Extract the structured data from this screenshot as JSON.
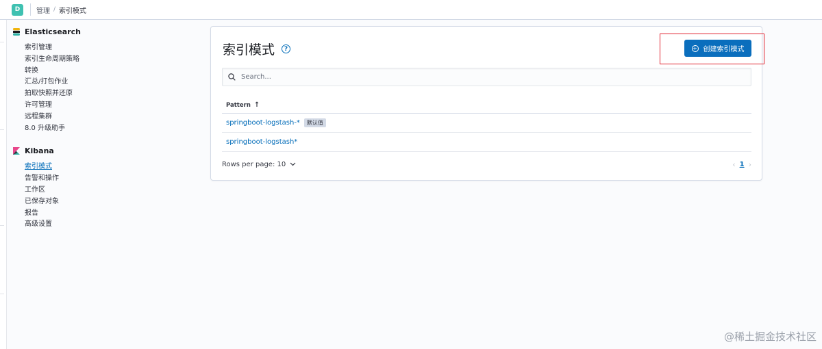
{
  "header": {
    "space_initial": "D",
    "breadcrumbs": [
      "管理",
      "索引模式"
    ]
  },
  "sidebar": {
    "sections": [
      {
        "title": "Elasticsearch",
        "items": [
          "索引管理",
          "索引生命周期策略",
          "转换",
          "汇总/打包作业",
          "拍取快照并还原",
          "许可管理",
          "远程集群",
          "8.0 升级助手"
        ]
      },
      {
        "title": "Kibana",
        "items": [
          "索引模式",
          "告警和操作",
          "工作区",
          "已保存对象",
          "报告",
          "高级设置"
        ]
      }
    ],
    "active_item": "索引模式"
  },
  "main": {
    "title": "索引模式",
    "create_button": "创建索引模式",
    "search_placeholder": "Search...",
    "table": {
      "column_header": "Pattern",
      "rows": [
        {
          "pattern": "springboot-logstash-*",
          "badge": "默认值"
        },
        {
          "pattern": "springboot-logstash*",
          "badge": ""
        }
      ]
    },
    "rows_per_page": "Rows per page: 10",
    "current_page": "1"
  },
  "watermark": "@稀土掘金技术社区",
  "colors": {
    "primary": "#0a6ebd",
    "link": "#006bb8",
    "highlight_border": "#e0212d",
    "space_avatar": "#3fc1b1"
  }
}
